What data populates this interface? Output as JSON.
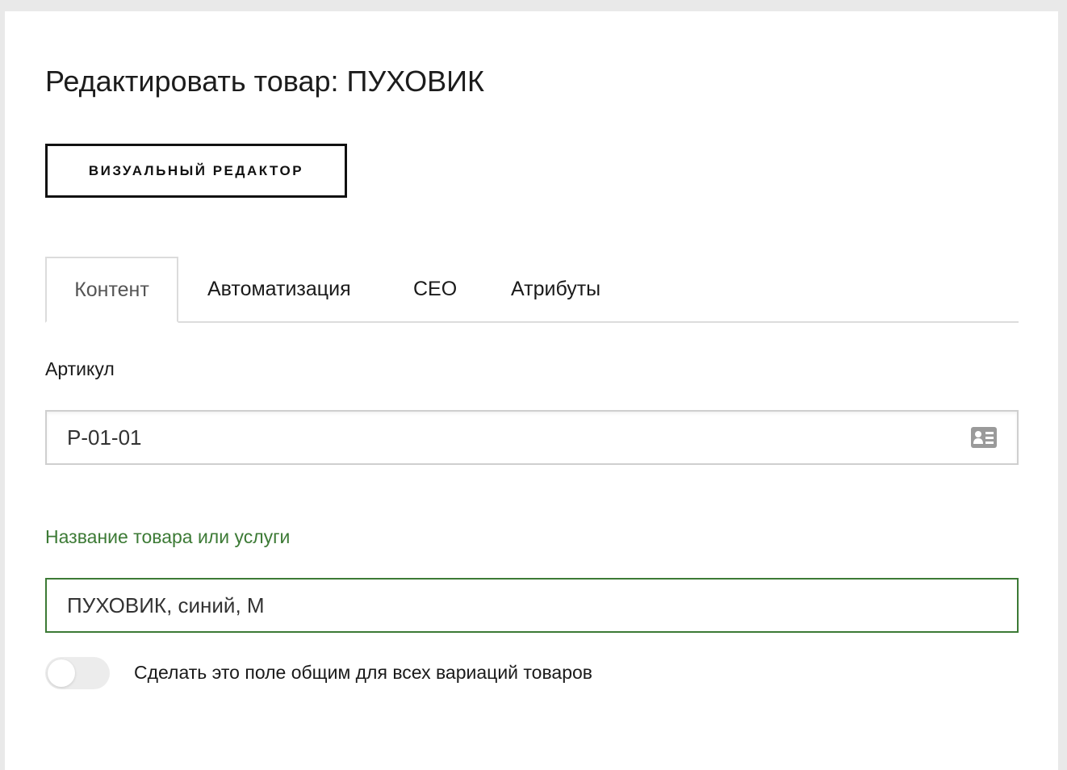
{
  "page": {
    "title": "Редактировать товар: ПУХОВИК"
  },
  "toolbar": {
    "visual_editor_label": "ВИЗУАЛЬНЫЙ РЕДАКТОР"
  },
  "tabs": [
    {
      "label": "Контент",
      "active": true
    },
    {
      "label": "Автоматизация",
      "active": false
    },
    {
      "label": "CEO",
      "active": false
    },
    {
      "label": "Атрибуты",
      "active": false
    }
  ],
  "fields": {
    "sku": {
      "label": "Артикул",
      "value": "P-01-01",
      "icon": "id-card-icon"
    },
    "name": {
      "label": "Название товара или услуги",
      "value": "ПУХОВИК, синий, M"
    }
  },
  "toggle": {
    "label": "Сделать это поле общим для всех вариаций товаров",
    "checked": false
  },
  "colors": {
    "accent_green": "#3c7a35",
    "border_gray": "#cfcfcf",
    "button_border": "#111111"
  }
}
